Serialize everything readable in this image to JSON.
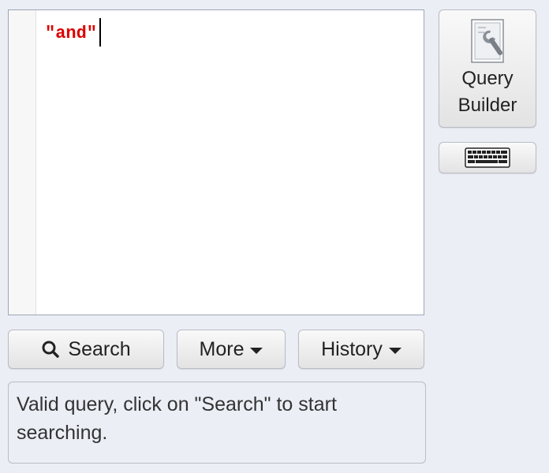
{
  "editor": {
    "query_text": "\"and\""
  },
  "query_builder": {
    "label_line1": "Query",
    "label_line2": "Builder",
    "icon": "wrench-document-icon"
  },
  "keyboard_button": {
    "icon": "keyboard-icon"
  },
  "toolbar": {
    "search_label": "Search",
    "search_icon": "search-icon",
    "more_label": "More",
    "history_label": "History"
  },
  "status": {
    "message": "Valid query, click on \"Search\" to start searching."
  }
}
